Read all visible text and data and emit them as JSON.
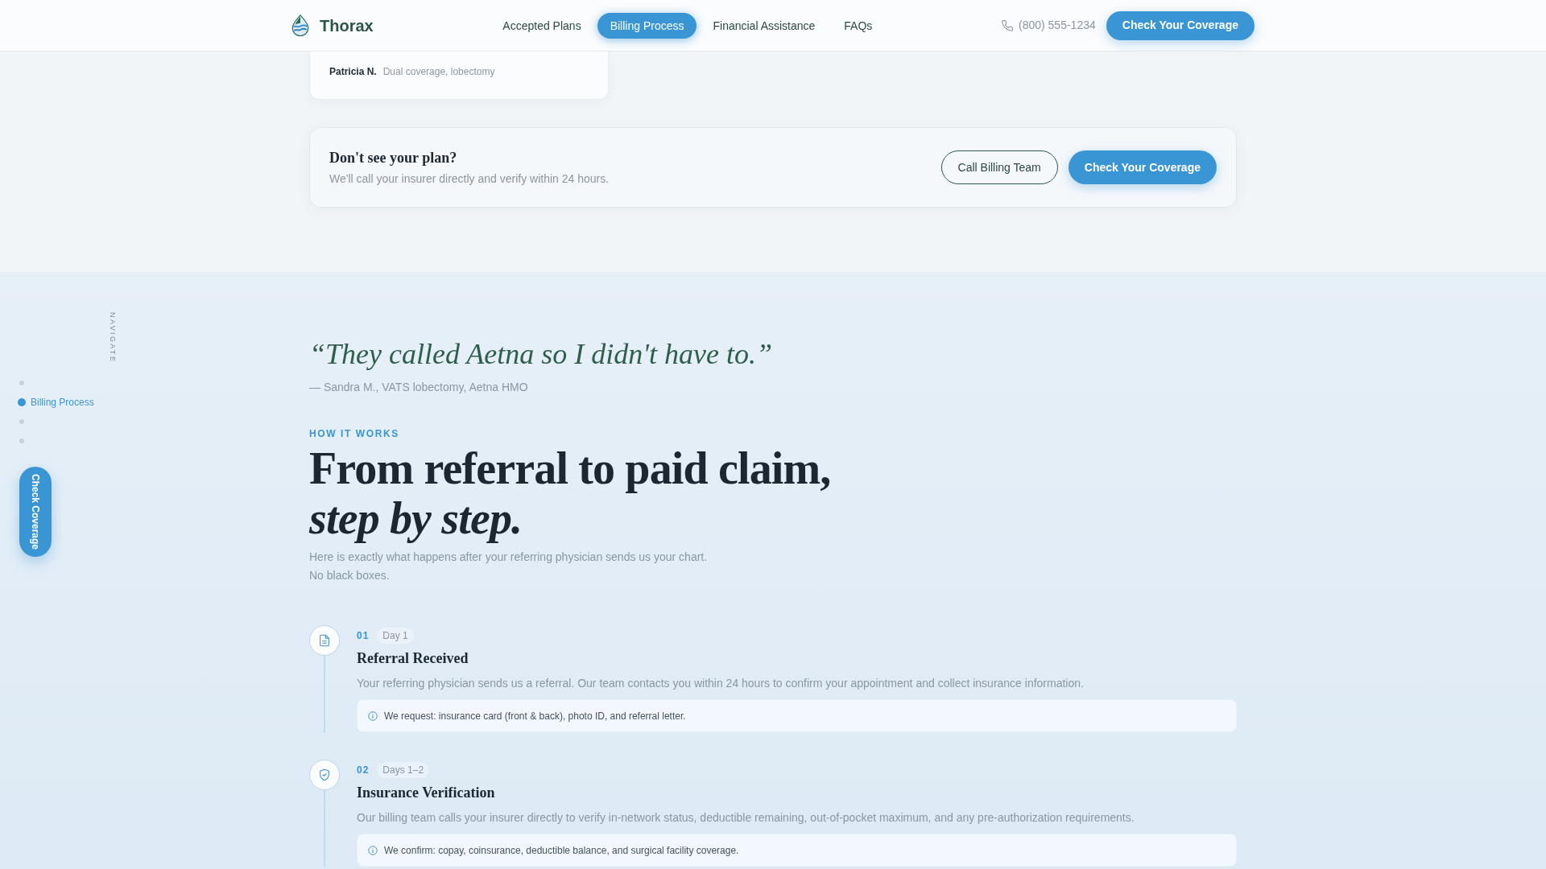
{
  "navbar": {
    "brand": "Thorax",
    "links": [
      {
        "label": "Accepted Plans",
        "selected": false
      },
      {
        "label": "Billing Process",
        "selected": true
      },
      {
        "label": "Financial Assistance",
        "selected": false
      },
      {
        "label": "FAQs",
        "selected": false
      }
    ],
    "phone": "(800) 555-1234",
    "cta": "Check Your Coverage"
  },
  "side_nav": {
    "heading": "NAVIGATE",
    "items": [
      {
        "selected": false
      },
      {
        "label": "Billing Process",
        "selected": true
      },
      {
        "selected": false
      },
      {
        "selected": false
      }
    ],
    "cta": "Check Coverage"
  },
  "testimonial_card": {
    "name": "Patricia N.",
    "detail": "Dual coverage, lobectomy"
  },
  "plan_cta": {
    "title": "Don't see your plan?",
    "text": "We'll call your insurer directly and verify within 24 hours.",
    "buttons": [
      {
        "label": "Call Billing Team",
        "kind": "outline"
      },
      {
        "label": "Check Your Coverage",
        "kind": "primary"
      }
    ]
  },
  "quote": {
    "text": "“They called Aetna so I didn't have to.”",
    "attribution": "— Sandra M., VATS lobectomy, Aetna HMO"
  },
  "how_it_works": {
    "eyebrow": "HOW IT WORKS",
    "heading": "From referral to paid claim, *step by step.*",
    "intro": [
      "Here is exactly what happens after your referring physician sends us your chart.",
      "No black boxes."
    ],
    "steps": [
      {
        "number": "01",
        "day": "Day 1",
        "title": "Referral Received",
        "text": "Your referring physician sends us a referral. Our team contacts you within 24 hours to confirm your appointment and collect insurance information.",
        "note": "We request: insurance card (front & back), photo ID, and referral letter."
      },
      {
        "number": "02",
        "day": "Days 1–2",
        "title": "Insurance Verification",
        "text": "Our billing team calls your insurer directly to verify in-network status, deductible remaining, out-of-pocket maximum, and any pre-authorization requirements.",
        "note": "We confirm: copay, coinsurance, deductible balance, and surgical facility coverage."
      }
    ]
  }
}
